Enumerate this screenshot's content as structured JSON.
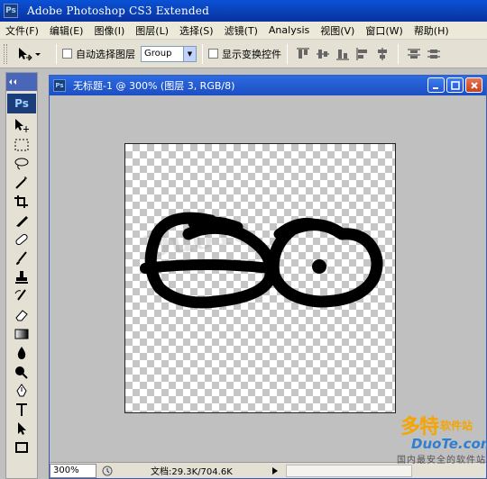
{
  "app": {
    "title": "Adobe Photoshop CS3 Extended",
    "icon": "Ps"
  },
  "menu": [
    "文件(F)",
    "编辑(E)",
    "图像(I)",
    "图层(L)",
    "选择(S)",
    "滤镜(T)",
    "Analysis",
    "视图(V)",
    "窗口(W)",
    "帮助(H)"
  ],
  "options": {
    "auto_select_label": "自动选择图层",
    "auto_select_value": "Group",
    "show_transform_label": "显示变换控件"
  },
  "toolbox": {
    "logo": "Ps"
  },
  "document": {
    "icon": "Ps",
    "title": "无标题-1 @ 300% (图层 3, RGB/8)",
    "zoom": "300%",
    "info": "文档:29.3K/704.6K",
    "watermark": "DuoTe"
  },
  "brand": {
    "name": "多特",
    "suffix": "软件站",
    "domain": "DuoTe.com",
    "tagline": "国内最安全的软件站"
  },
  "colors": {
    "titlebar": "#0a3fb3",
    "doc_titlebar": "#1d4fc4",
    "brand_orange": "#f6a400",
    "brand_blue": "#2f7fd0"
  }
}
